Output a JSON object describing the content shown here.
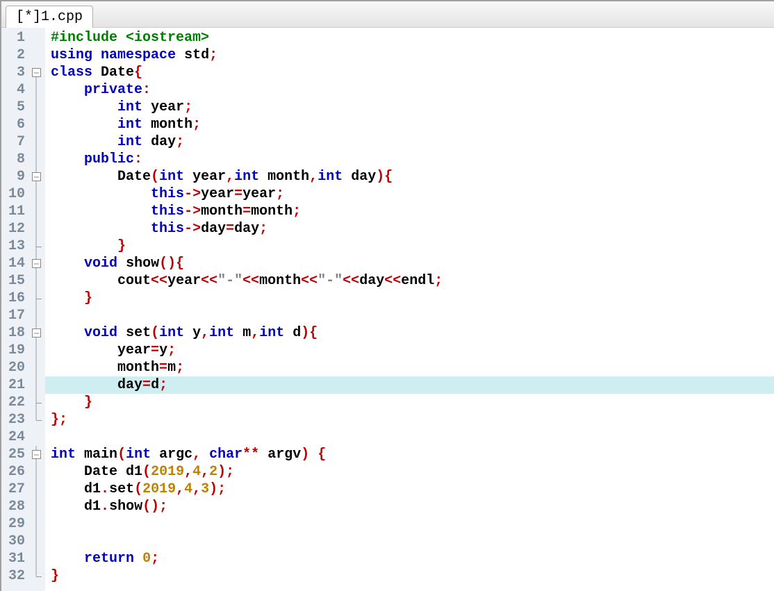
{
  "tab": {
    "label": "[*]1.cpp"
  },
  "first_line": 1,
  "last_line": 32,
  "highlight_line": 21,
  "code_tokens": {
    "l1": [
      [
        "pp",
        "#include <iostream>"
      ]
    ],
    "l2": [
      [
        "kw",
        "using"
      ],
      [
        "pl",
        " "
      ],
      [
        "kw",
        "namespace"
      ],
      [
        "pl",
        " "
      ],
      [
        "id",
        "std"
      ],
      [
        "op",
        ";"
      ]
    ],
    "l3": [
      [
        "kw",
        "class"
      ],
      [
        "pl",
        " "
      ],
      [
        "id",
        "Date"
      ],
      [
        "op",
        "{"
      ]
    ],
    "l4": [
      [
        "pl",
        "    "
      ],
      [
        "kw",
        "private"
      ],
      [
        "op",
        ":"
      ]
    ],
    "l5": [
      [
        "pl",
        "        "
      ],
      [
        "kw",
        "int"
      ],
      [
        "pl",
        " "
      ],
      [
        "id",
        "year"
      ],
      [
        "op",
        ";"
      ]
    ],
    "l6": [
      [
        "pl",
        "        "
      ],
      [
        "kw",
        "int"
      ],
      [
        "pl",
        " "
      ],
      [
        "id",
        "month"
      ],
      [
        "op",
        ";"
      ]
    ],
    "l7": [
      [
        "pl",
        "        "
      ],
      [
        "kw",
        "int"
      ],
      [
        "pl",
        " "
      ],
      [
        "id",
        "day"
      ],
      [
        "op",
        ";"
      ]
    ],
    "l8": [
      [
        "pl",
        "    "
      ],
      [
        "kw",
        "public"
      ],
      [
        "op",
        ":"
      ]
    ],
    "l9": [
      [
        "pl",
        "        "
      ],
      [
        "id",
        "Date"
      ],
      [
        "op",
        "("
      ],
      [
        "kw",
        "int"
      ],
      [
        "pl",
        " "
      ],
      [
        "id",
        "year"
      ],
      [
        "op",
        ","
      ],
      [
        "kw",
        "int"
      ],
      [
        "pl",
        " "
      ],
      [
        "id",
        "month"
      ],
      [
        "op",
        ","
      ],
      [
        "kw",
        "int"
      ],
      [
        "pl",
        " "
      ],
      [
        "id",
        "day"
      ],
      [
        "op",
        "){"
      ]
    ],
    "l10": [
      [
        "pl",
        "            "
      ],
      [
        "kw",
        "this"
      ],
      [
        "op",
        "->"
      ],
      [
        "id",
        "year"
      ],
      [
        "op",
        "="
      ],
      [
        "id",
        "year"
      ],
      [
        "op",
        ";"
      ]
    ],
    "l11": [
      [
        "pl",
        "            "
      ],
      [
        "kw",
        "this"
      ],
      [
        "op",
        "->"
      ],
      [
        "id",
        "month"
      ],
      [
        "op",
        "="
      ],
      [
        "id",
        "month"
      ],
      [
        "op",
        ";"
      ]
    ],
    "l12": [
      [
        "pl",
        "            "
      ],
      [
        "kw",
        "this"
      ],
      [
        "op",
        "->"
      ],
      [
        "id",
        "day"
      ],
      [
        "op",
        "="
      ],
      [
        "id",
        "day"
      ],
      [
        "op",
        ";"
      ]
    ],
    "l13": [
      [
        "pl",
        "        "
      ],
      [
        "op",
        "}"
      ]
    ],
    "l14": [
      [
        "pl",
        "    "
      ],
      [
        "kw",
        "void"
      ],
      [
        "pl",
        " "
      ],
      [
        "id",
        "show"
      ],
      [
        "op",
        "(){"
      ]
    ],
    "l15": [
      [
        "pl",
        "        "
      ],
      [
        "id",
        "cout"
      ],
      [
        "op",
        "<<"
      ],
      [
        "id",
        "year"
      ],
      [
        "op",
        "<<"
      ],
      [
        "str",
        "\"-\""
      ],
      [
        "op",
        "<<"
      ],
      [
        "id",
        "month"
      ],
      [
        "op",
        "<<"
      ],
      [
        "str",
        "\"-\""
      ],
      [
        "op",
        "<<"
      ],
      [
        "id",
        "day"
      ],
      [
        "op",
        "<<"
      ],
      [
        "id",
        "endl"
      ],
      [
        "op",
        ";"
      ]
    ],
    "l16": [
      [
        "pl",
        "    "
      ],
      [
        "op",
        "}"
      ]
    ],
    "l17": [
      [
        "pl",
        ""
      ]
    ],
    "l18": [
      [
        "pl",
        "    "
      ],
      [
        "kw",
        "void"
      ],
      [
        "pl",
        " "
      ],
      [
        "id",
        "set"
      ],
      [
        "op",
        "("
      ],
      [
        "kw",
        "int"
      ],
      [
        "pl",
        " "
      ],
      [
        "id",
        "y"
      ],
      [
        "op",
        ","
      ],
      [
        "kw",
        "int"
      ],
      [
        "pl",
        " "
      ],
      [
        "id",
        "m"
      ],
      [
        "op",
        ","
      ],
      [
        "kw",
        "int"
      ],
      [
        "pl",
        " "
      ],
      [
        "id",
        "d"
      ],
      [
        "op",
        "){"
      ]
    ],
    "l19": [
      [
        "pl",
        "        "
      ],
      [
        "id",
        "year"
      ],
      [
        "op",
        "="
      ],
      [
        "id",
        "y"
      ],
      [
        "op",
        ";"
      ]
    ],
    "l20": [
      [
        "pl",
        "        "
      ],
      [
        "id",
        "month"
      ],
      [
        "op",
        "="
      ],
      [
        "id",
        "m"
      ],
      [
        "op",
        ";"
      ]
    ],
    "l21": [
      [
        "pl",
        "        "
      ],
      [
        "id",
        "day"
      ],
      [
        "op",
        "="
      ],
      [
        "id",
        "d"
      ],
      [
        "op",
        ";"
      ]
    ],
    "l22": [
      [
        "pl",
        "    "
      ],
      [
        "op",
        "}"
      ]
    ],
    "l23": [
      [
        "op",
        "};"
      ]
    ],
    "l24": [
      [
        "pl",
        ""
      ]
    ],
    "l25": [
      [
        "kw",
        "int"
      ],
      [
        "pl",
        " "
      ],
      [
        "id",
        "main"
      ],
      [
        "op",
        "("
      ],
      [
        "kw",
        "int"
      ],
      [
        "pl",
        " "
      ],
      [
        "id",
        "argc"
      ],
      [
        "op",
        ","
      ],
      [
        "pl",
        " "
      ],
      [
        "kw",
        "char"
      ],
      [
        "op",
        "**"
      ],
      [
        "pl",
        " "
      ],
      [
        "id",
        "argv"
      ],
      [
        "op",
        ")"
      ],
      [
        "pl",
        " "
      ],
      [
        "op",
        "{"
      ]
    ],
    "l26": [
      [
        "pl",
        "    "
      ],
      [
        "id",
        "Date d1"
      ],
      [
        "op",
        "("
      ],
      [
        "num",
        "2019"
      ],
      [
        "op",
        ","
      ],
      [
        "num",
        "4"
      ],
      [
        "op",
        ","
      ],
      [
        "num",
        "2"
      ],
      [
        "op",
        ");"
      ]
    ],
    "l27": [
      [
        "pl",
        "    "
      ],
      [
        "id",
        "d1"
      ],
      [
        "op",
        "."
      ],
      [
        "id",
        "set"
      ],
      [
        "op",
        "("
      ],
      [
        "num",
        "2019"
      ],
      [
        "op",
        ","
      ],
      [
        "num",
        "4"
      ],
      [
        "op",
        ","
      ],
      [
        "num",
        "3"
      ],
      [
        "op",
        ");"
      ]
    ],
    "l28": [
      [
        "pl",
        "    "
      ],
      [
        "id",
        "d1"
      ],
      [
        "op",
        "."
      ],
      [
        "id",
        "show"
      ],
      [
        "op",
        "();"
      ]
    ],
    "l29": [
      [
        "pl",
        ""
      ]
    ],
    "l30": [
      [
        "pl",
        ""
      ]
    ],
    "l31": [
      [
        "pl",
        "    "
      ],
      [
        "kw",
        "return"
      ],
      [
        "pl",
        " "
      ],
      [
        "num",
        "0"
      ],
      [
        "op",
        ";"
      ]
    ],
    "l32": [
      [
        "op",
        "}"
      ]
    ]
  },
  "fold_markers": {
    "3": "open",
    "9": "open",
    "13": "tee",
    "14": "open",
    "16": "tee",
    "18": "open",
    "22": "tee",
    "23": "end",
    "25": "open",
    "32": "end"
  }
}
